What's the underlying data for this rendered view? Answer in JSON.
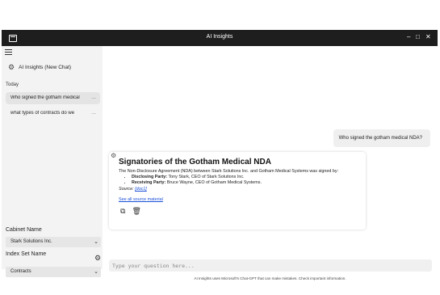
{
  "window": {
    "title": "AI Insights",
    "controls": {
      "minimize": "–",
      "maximize": "□",
      "close": "✕"
    }
  },
  "sidebar": {
    "menu_icon": "hamburger-icon",
    "new_chat_label": "AI Insights (New Chat)",
    "section_today": "Today",
    "history": [
      {
        "label": "Who signed the gotham medical",
        "more": "..."
      },
      {
        "label": "what types of contracts do we",
        "more": "..."
      }
    ],
    "cabinet_label": "Cabinet Name",
    "cabinet_value": "Stark Solutions Inc.",
    "index_label": "Index Set Name",
    "index_value": "Contracts"
  },
  "chat": {
    "user_message": "Who signed the gotham medical NDA?",
    "assistant": {
      "title": "Signatories of the Gotham Medical NDA",
      "intro": "The Non-Disclosure Agreement (NDA) between Stark Solutions Inc. and Gotham Medical Systems was signed by:",
      "parties": [
        {
          "role": "Disclosing Party:",
          "detail": "Tony Stark, CEO of Stark Solutions Inc."
        },
        {
          "role": "Receiving Party:",
          "detail": "Bruce Wayne, CEO of Gotham Medical Systems."
        }
      ],
      "source_label": "Source:",
      "source_link": "[doc1]",
      "all_sources_link": "See all source material"
    }
  },
  "input": {
    "placeholder": "Type your question here...",
    "disclaimer": "AI Insights uses Microsoft's Chat-GPT that can make mistakes. Check important information."
  },
  "colors": {
    "titlebar": "#1e1e1e",
    "sidebar": "#f3f3f3",
    "link": "#1a4fd6"
  }
}
